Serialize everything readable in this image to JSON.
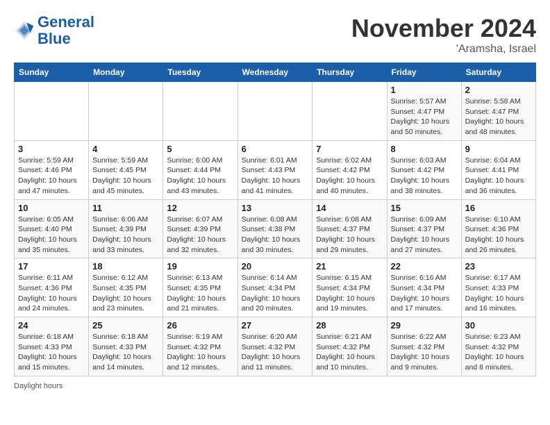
{
  "header": {
    "logo_line1": "General",
    "logo_line2": "Blue",
    "month": "November 2024",
    "location": "'Aramsha, Israel"
  },
  "weekdays": [
    "Sunday",
    "Monday",
    "Tuesday",
    "Wednesday",
    "Thursday",
    "Friday",
    "Saturday"
  ],
  "weeks": [
    [
      {
        "day": "",
        "info": ""
      },
      {
        "day": "",
        "info": ""
      },
      {
        "day": "",
        "info": ""
      },
      {
        "day": "",
        "info": ""
      },
      {
        "day": "",
        "info": ""
      },
      {
        "day": "1",
        "info": "Sunrise: 5:57 AM\nSunset: 4:47 PM\nDaylight: 10 hours\nand 50 minutes."
      },
      {
        "day": "2",
        "info": "Sunrise: 5:58 AM\nSunset: 4:47 PM\nDaylight: 10 hours\nand 48 minutes."
      }
    ],
    [
      {
        "day": "3",
        "info": "Sunrise: 5:59 AM\nSunset: 4:46 PM\nDaylight: 10 hours\nand 47 minutes."
      },
      {
        "day": "4",
        "info": "Sunrise: 5:59 AM\nSunset: 4:45 PM\nDaylight: 10 hours\nand 45 minutes."
      },
      {
        "day": "5",
        "info": "Sunrise: 6:00 AM\nSunset: 4:44 PM\nDaylight: 10 hours\nand 43 minutes."
      },
      {
        "day": "6",
        "info": "Sunrise: 6:01 AM\nSunset: 4:43 PM\nDaylight: 10 hours\nand 41 minutes."
      },
      {
        "day": "7",
        "info": "Sunrise: 6:02 AM\nSunset: 4:42 PM\nDaylight: 10 hours\nand 40 minutes."
      },
      {
        "day": "8",
        "info": "Sunrise: 6:03 AM\nSunset: 4:42 PM\nDaylight: 10 hours\nand 38 minutes."
      },
      {
        "day": "9",
        "info": "Sunrise: 6:04 AM\nSunset: 4:41 PM\nDaylight: 10 hours\nand 36 minutes."
      }
    ],
    [
      {
        "day": "10",
        "info": "Sunrise: 6:05 AM\nSunset: 4:40 PM\nDaylight: 10 hours\nand 35 minutes."
      },
      {
        "day": "11",
        "info": "Sunrise: 6:06 AM\nSunset: 4:39 PM\nDaylight: 10 hours\nand 33 minutes."
      },
      {
        "day": "12",
        "info": "Sunrise: 6:07 AM\nSunset: 4:39 PM\nDaylight: 10 hours\nand 32 minutes."
      },
      {
        "day": "13",
        "info": "Sunrise: 6:08 AM\nSunset: 4:38 PM\nDaylight: 10 hours\nand 30 minutes."
      },
      {
        "day": "14",
        "info": "Sunrise: 6:08 AM\nSunset: 4:37 PM\nDaylight: 10 hours\nand 29 minutes."
      },
      {
        "day": "15",
        "info": "Sunrise: 6:09 AM\nSunset: 4:37 PM\nDaylight: 10 hours\nand 27 minutes."
      },
      {
        "day": "16",
        "info": "Sunrise: 6:10 AM\nSunset: 4:36 PM\nDaylight: 10 hours\nand 26 minutes."
      }
    ],
    [
      {
        "day": "17",
        "info": "Sunrise: 6:11 AM\nSunset: 4:36 PM\nDaylight: 10 hours\nand 24 minutes."
      },
      {
        "day": "18",
        "info": "Sunrise: 6:12 AM\nSunset: 4:35 PM\nDaylight: 10 hours\nand 23 minutes."
      },
      {
        "day": "19",
        "info": "Sunrise: 6:13 AM\nSunset: 4:35 PM\nDaylight: 10 hours\nand 21 minutes."
      },
      {
        "day": "20",
        "info": "Sunrise: 6:14 AM\nSunset: 4:34 PM\nDaylight: 10 hours\nand 20 minutes."
      },
      {
        "day": "21",
        "info": "Sunrise: 6:15 AM\nSunset: 4:34 PM\nDaylight: 10 hours\nand 19 minutes."
      },
      {
        "day": "22",
        "info": "Sunrise: 6:16 AM\nSunset: 4:34 PM\nDaylight: 10 hours\nand 17 minutes."
      },
      {
        "day": "23",
        "info": "Sunrise: 6:17 AM\nSunset: 4:33 PM\nDaylight: 10 hours\nand 16 minutes."
      }
    ],
    [
      {
        "day": "24",
        "info": "Sunrise: 6:18 AM\nSunset: 4:33 PM\nDaylight: 10 hours\nand 15 minutes."
      },
      {
        "day": "25",
        "info": "Sunrise: 6:18 AM\nSunset: 4:33 PM\nDaylight: 10 hours\nand 14 minutes."
      },
      {
        "day": "26",
        "info": "Sunrise: 6:19 AM\nSunset: 4:32 PM\nDaylight: 10 hours\nand 12 minutes."
      },
      {
        "day": "27",
        "info": "Sunrise: 6:20 AM\nSunset: 4:32 PM\nDaylight: 10 hours\nand 11 minutes."
      },
      {
        "day": "28",
        "info": "Sunrise: 6:21 AM\nSunset: 4:32 PM\nDaylight: 10 hours\nand 10 minutes."
      },
      {
        "day": "29",
        "info": "Sunrise: 6:22 AM\nSunset: 4:32 PM\nDaylight: 10 hours\nand 9 minutes."
      },
      {
        "day": "30",
        "info": "Sunrise: 6:23 AM\nSunset: 4:32 PM\nDaylight: 10 hours\nand 8 minutes."
      }
    ]
  ],
  "footer": "Daylight hours"
}
